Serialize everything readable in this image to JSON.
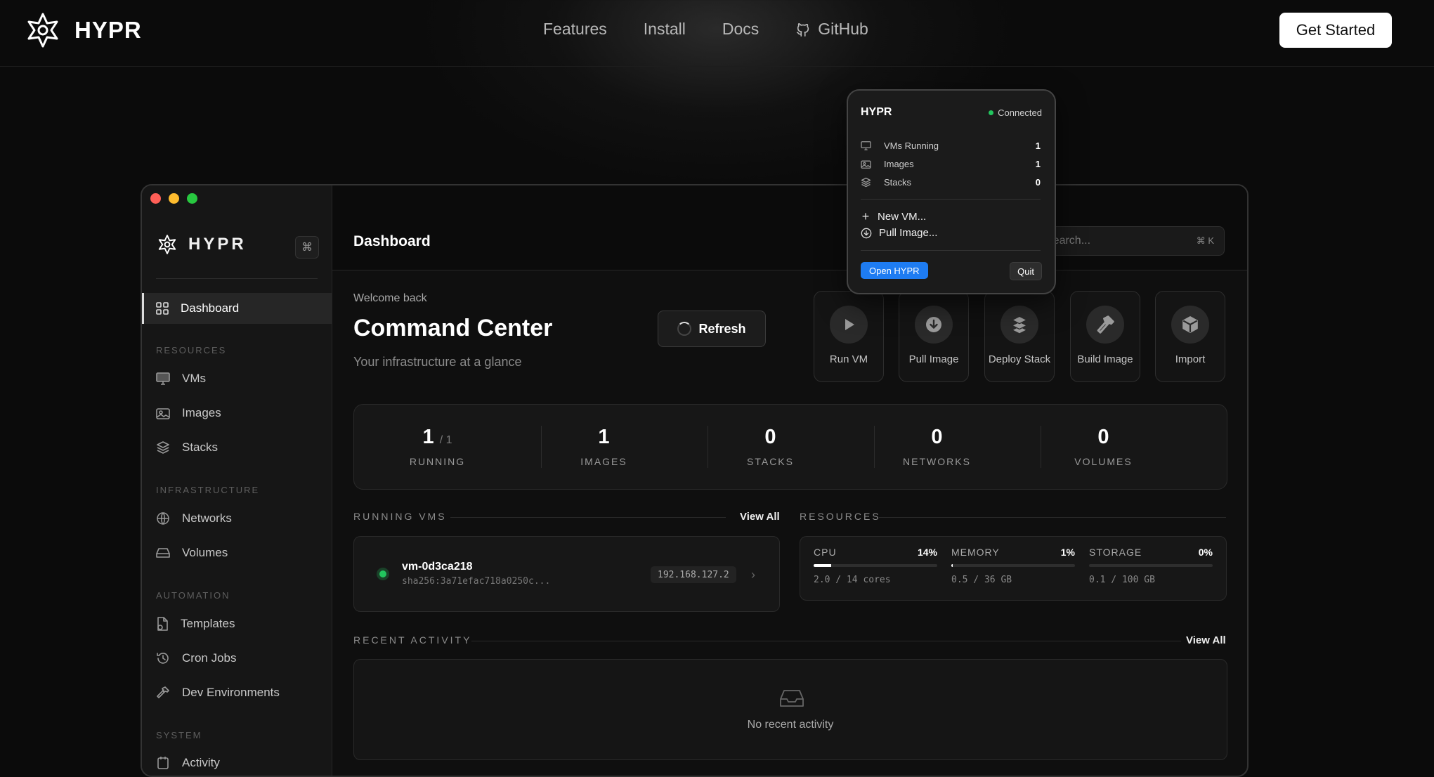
{
  "nav": {
    "brand": "HYPR",
    "links": [
      "Features",
      "Install",
      "Docs",
      "GitHub"
    ],
    "cta": "Get Started"
  },
  "app": {
    "brand": "HYPR",
    "cmd_key": "⌘",
    "sidebar": {
      "dashboard": "Dashboard",
      "sections": {
        "resources": "RESOURCES",
        "infrastructure": "INFRASTRUCTURE",
        "automation": "AUTOMATION",
        "system": "SYSTEM"
      },
      "items": {
        "vms": "VMs",
        "images": "Images",
        "stacks": "Stacks",
        "networks": "Networks",
        "volumes": "Volumes",
        "templates": "Templates",
        "cron_jobs": "Cron Jobs",
        "dev_envs": "Dev Environments",
        "activity": "Activity"
      }
    },
    "header": {
      "title": "Dashboard",
      "search_placeholder": "Search...",
      "search_shortcut": "⌘ K"
    },
    "hero": {
      "welcome": "Welcome back",
      "title": "Command Center",
      "subtitle": "Your infrastructure at a glance",
      "refresh": "Refresh"
    },
    "quick_actions": [
      "Run VM",
      "Pull Image",
      "Deploy Stack",
      "Build Image",
      "Import"
    ],
    "stats": {
      "running": {
        "value": "1",
        "total": "/ 1",
        "label": "RUNNING"
      },
      "images": {
        "value": "1",
        "label": "IMAGES"
      },
      "stacks": {
        "value": "0",
        "label": "STACKS"
      },
      "networks": {
        "value": "0",
        "label": "NETWORKS"
      },
      "volumes": {
        "value": "0",
        "label": "VOLUMES"
      }
    },
    "running_vms": {
      "heading": "RUNNING VMS",
      "view_all": "View All",
      "vm": {
        "name": "vm-0d3ca218",
        "hash": "sha256:3a71efac718a0250c...",
        "ip": "192.168.127.2",
        "status_color": "#22c55e"
      }
    },
    "resources": {
      "heading": "RESOURCES",
      "cpu": {
        "label": "CPU",
        "percent_text": "14%",
        "percent": 14,
        "detail": "2.0 / 14 cores"
      },
      "memory": {
        "label": "MEMORY",
        "percent_text": "1%",
        "percent": 1,
        "detail": "0.5 / 36 GB"
      },
      "storage": {
        "label": "STORAGE",
        "percent_text": "0%",
        "percent": 0,
        "detail": "0.1 / 100 GB"
      }
    },
    "activity": {
      "heading": "RECENT ACTIVITY",
      "view_all": "View All",
      "empty": "No recent activity"
    }
  },
  "popover": {
    "title": "HYPR",
    "status": "Connected",
    "rows": {
      "vms_running": {
        "label": "VMs Running",
        "value": "1"
      },
      "images": {
        "label": "Images",
        "value": "1"
      },
      "stacks": {
        "label": "Stacks",
        "value": "0"
      }
    },
    "new_vm": "New VM...",
    "pull_image": "Pull Image...",
    "open": "Open HYPR",
    "quit": "Quit"
  },
  "colors": {
    "accent_blue": "#1e7cf2",
    "status_green": "#22c55e",
    "traffic_red": "#ff5f57",
    "traffic_yellow": "#febc2e",
    "traffic_green": "#28c840"
  }
}
